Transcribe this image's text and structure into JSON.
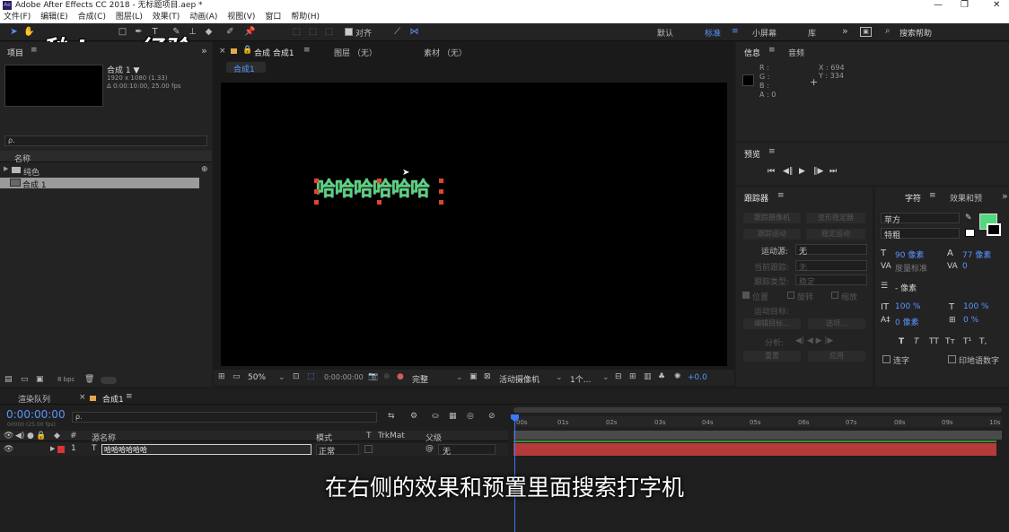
{
  "window": {
    "title": "Adobe After Effects CC 2018 - 无标题项目.aep *",
    "app_icon": "Ae"
  },
  "menu": [
    "文件(F)",
    "编辑(E)",
    "合成(C)",
    "图层(L)",
    "效果(T)",
    "动画(A)",
    "视图(V)",
    "窗口",
    "帮助(H)"
  ],
  "toolbar": {
    "align_label": "对齐",
    "workspaces": [
      "默认",
      "标准",
      "小屏幕",
      "库"
    ],
    "active_workspace": "标准",
    "search_placeholder": "搜索帮助",
    "more": "»"
  },
  "watermark": "秒dong经验",
  "project": {
    "tab": "项目",
    "comp_name": "合成 1 ▼",
    "comp_info1": "1920 x 1080 (1.33)",
    "comp_info2": "Δ 0:00:10:00, 25.00 fps",
    "search_glyph": "ρ.",
    "col_name": "名称",
    "items": [
      {
        "name": "纯色",
        "type": "folder"
      },
      {
        "name": "合成 1",
        "type": "comp"
      }
    ],
    "bpc": "8 bpc"
  },
  "viewer_tabs": {
    "comp_tab": "合成 合成1",
    "layer_tab": "图层 （无）",
    "footage_tab": "素材 （无）",
    "subtab": "合成1"
  },
  "viewer": {
    "text_layer": "哈哈哈哈哈哈",
    "zoom": "50%",
    "timecode": "0:00:00:00",
    "quality": "完整",
    "camera": "活动摄像机",
    "views": "1个...",
    "exposure": "+0.0"
  },
  "info": {
    "tab": "信息",
    "audio_tab": "音频",
    "r": "R :",
    "g": "G :",
    "b": "B :",
    "a": "A : 0",
    "x": "X : 694",
    "y": "Y : 334"
  },
  "preview": {
    "tab": "预览"
  },
  "tracker": {
    "tab": "跟踪器",
    "track_camera": "跟踪摄像机",
    "warp_stabilizer": "变形稳定器",
    "track_motion": "跟踪运动",
    "stabilize_motion": "稳定运动",
    "motion_source_label": "运动源:",
    "motion_source": "无",
    "current_track_label": "当前跟踪:",
    "current_track": "无",
    "track_type_label": "跟踪类型:",
    "track_type": "稳定",
    "position": "位置",
    "rotation": "旋转",
    "scale": "缩放",
    "motion_target_label": "运动目标:",
    "edit_target": "编辑目标...",
    "options": "选项...",
    "analyze": "分析:",
    "reset": "重置",
    "apply": "应用"
  },
  "character": {
    "tab": "字符",
    "effects_tab": "效果和预",
    "font": "苹方",
    "style": "特粗",
    "size": "90 像素",
    "leading": "77 像素",
    "kerning": "度量标准",
    "tracking": "0",
    "stroke_unit": "- 像素",
    "vscale": "100 %",
    "hscale": "100 %",
    "baseline": "0 像素",
    "tsume": "0 %",
    "ligatures": "连字",
    "hindi_digits": "印地语数字",
    "fill_color": "#52d67e",
    "styles": [
      "T",
      "T",
      "TT",
      "Tт",
      "T¹",
      "T,"
    ]
  },
  "timeline": {
    "render_tab": "渲染队列",
    "comp_tab": "合成1",
    "timecode": "0:00:00:00",
    "frame_info": "00000 (25.00 fps)",
    "col_layer": "源名称",
    "col_mode": "模式",
    "col_t": "T",
    "col_trkmat": "TrkMat",
    "col_parent": "父级",
    "layer_num": "1",
    "layer_name": "哈哈哈哈哈哈",
    "layer_mode": "正常",
    "layer_parent": "无",
    "ruler": [
      "00s",
      "01s",
      "02s",
      "03s",
      "04s",
      "05s",
      "06s",
      "07s",
      "08s",
      "09s",
      "10s"
    ]
  },
  "subtitle": "在右侧的效果和预置里面搜索打字机"
}
